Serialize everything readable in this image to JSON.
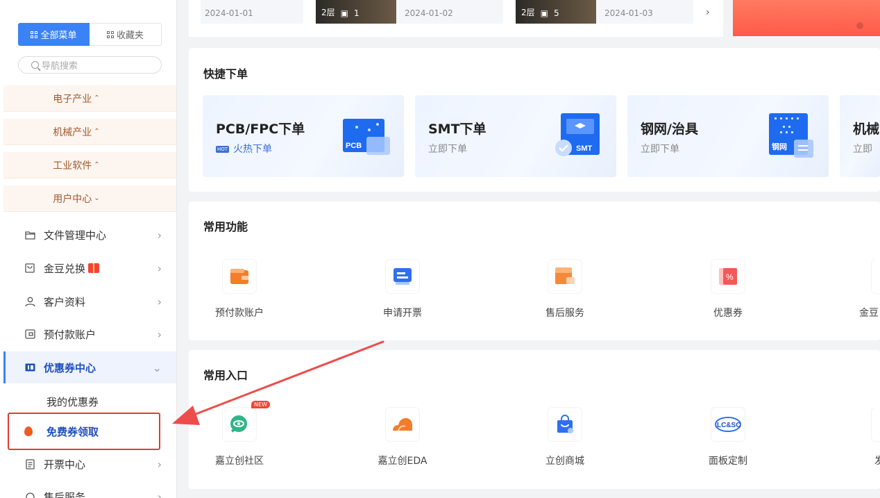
{
  "sidebar": {
    "tab_all": "全部菜单",
    "tab_fav": "收藏夹",
    "search_placeholder": "导航搜索",
    "categories": [
      {
        "label": "电子产业",
        "arrow": "^"
      },
      {
        "label": "机械产业",
        "arrow": "^"
      },
      {
        "label": "工业软件",
        "arrow": "^"
      },
      {
        "label": "用户中心",
        "arrow": "v"
      }
    ],
    "items": [
      {
        "label": "文件管理中心"
      },
      {
        "label": "金豆兑换"
      },
      {
        "label": "客户资料"
      },
      {
        "label": "预付款账户"
      },
      {
        "label": "优惠券中心"
      },
      {
        "label": "开票中心"
      },
      {
        "label": "售后服务"
      }
    ],
    "sub_items": {
      "my_coupons": "我的优惠券",
      "free_coupon": "免费券领取"
    }
  },
  "top_strip": {
    "cards": [
      {
        "date": "2024-01-01"
      },
      {
        "layers": "2层",
        "count": "1",
        "date": "2024-01-02"
      },
      {
        "layers": "2层",
        "count": "5",
        "date": "2024-01-03"
      }
    ]
  },
  "quick_order": {
    "title": "快捷下单",
    "cards": [
      {
        "title": "PCB/FPC下单",
        "badge": "HOT",
        "sub": "火热下单",
        "art": "PCB"
      },
      {
        "title": "SMT下单",
        "sub": "立即下单",
        "art": "SMT"
      },
      {
        "title": "钢网/治具",
        "sub": "立即下单",
        "art": "钢网"
      },
      {
        "title": "机械",
        "sub": "立即"
      }
    ]
  },
  "common_functions": {
    "title": "常用功能",
    "items": [
      {
        "label": "预付款账户",
        "icon": "wallet-icon"
      },
      {
        "label": "申请开票",
        "icon": "invoice-icon"
      },
      {
        "label": "售后服务",
        "icon": "service-box-icon"
      },
      {
        "label": "优惠券",
        "icon": "coupon-icon"
      },
      {
        "label": "金豆",
        "icon": "bean-icon"
      }
    ]
  },
  "common_entries": {
    "title": "常用入口",
    "items": [
      {
        "label": "嘉立创社区",
        "icon": "community-icon",
        "badge": "NEW"
      },
      {
        "label": "嘉立创EDA",
        "icon": "eda-icon"
      },
      {
        "label": "立创商城",
        "icon": "mall-bag-icon"
      },
      {
        "label": "面板定制",
        "icon": "lcsc-panel-icon",
        "logo_text": "LC&SC"
      },
      {
        "label": "发",
        "icon": "other-icon"
      }
    ]
  },
  "colors": {
    "accent": "#3b82f6",
    "highlight": "#e53935",
    "category_bg": "#fdf5f0",
    "category_text": "#a25a2d"
  }
}
